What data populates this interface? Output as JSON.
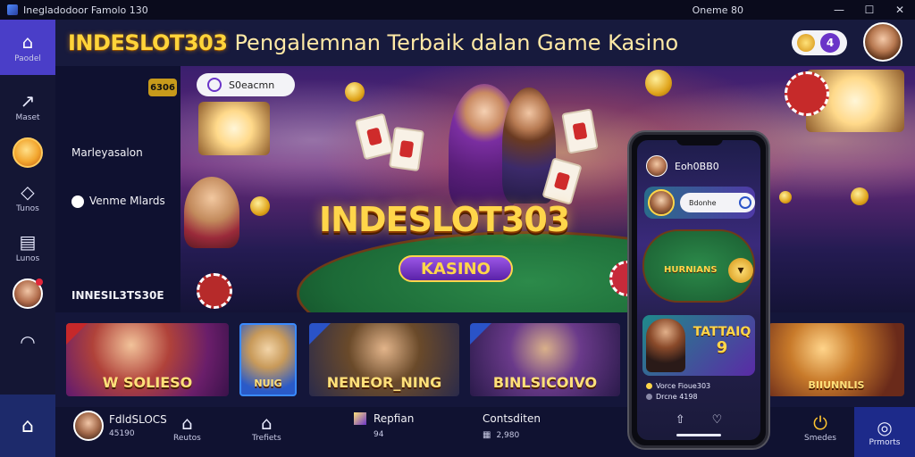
{
  "window": {
    "title": "Inegladodoor Famolo 130",
    "status": "Oneme 80",
    "minimize": "—",
    "maximize": "☐",
    "close": "✕"
  },
  "sidebar": {
    "items": [
      {
        "label": "Paodel",
        "icon": "home-icon",
        "glyph": "⌂"
      },
      {
        "label": "Maset",
        "icon": "trend-icon",
        "glyph": "↗"
      },
      {
        "label": "",
        "icon": "mascot-avatar"
      },
      {
        "label": "Tunos",
        "icon": "leaf-icon",
        "glyph": "◇"
      },
      {
        "label": "Lunos",
        "icon": "wallet-icon",
        "glyph": "▤"
      },
      {
        "label": "",
        "icon": "user-avatar"
      },
      {
        "label": "",
        "icon": "support-icon",
        "glyph": "◠"
      }
    ],
    "bottom_icon": "home-icon",
    "bottom_glyph": "⌂"
  },
  "header": {
    "logo": "INDESLOT303",
    "tagline": "Pengalemnan Terbaik dalan Game Kasino",
    "badge_count": "4",
    "coin_icon": "coin-icon"
  },
  "promo": {
    "badge": "6306",
    "text1": "Marleyasalon",
    "text2": "Venme Mlards",
    "text3": "INNESIL3TS30E"
  },
  "hero": {
    "search_placeholder": "S0eacmn",
    "headline": "INDESLOT303",
    "sub_badge": "KASINO"
  },
  "games": [
    {
      "title": "W SOLIESO",
      "tag": "red"
    },
    {
      "title": "NUIG",
      "tag": "blue"
    },
    {
      "title": "NENEOR_NING",
      "tag": "blue"
    },
    {
      "title": "BINLSICOIVO",
      "tag": "blue"
    },
    {
      "title": "BIIUNNLIS",
      "tag": "red"
    }
  ],
  "bottom_nav": {
    "user_name": "FdldSLOCS",
    "user_sub": "45190",
    "items": [
      {
        "label": "Reutos",
        "icon": "shield-icon",
        "glyph": "⌂"
      },
      {
        "label": "Trefiets",
        "icon": "bag-icon",
        "glyph": "⌂"
      }
    ],
    "reports_title": "Repfian",
    "reports_sub": "94",
    "contacts_title": "Contsditen",
    "contacts_sub": "2,980",
    "power_label": "Smedes",
    "active_label": "Prmorts"
  },
  "phone": {
    "user": "Eoh0BB0",
    "card_pill": "Bdonhe",
    "table_label": "HURNIANS",
    "promo_big_1": "TATTAIQ",
    "promo_big_2": "9",
    "info_1": "Vorce Fioue303",
    "info_2": "Drcne 4198"
  },
  "colors": {
    "accent_purple": "#6a34c8",
    "gold": "#ffd43a",
    "sidebar_bg": "#141634",
    "nav_active": "#1d2a8a"
  }
}
